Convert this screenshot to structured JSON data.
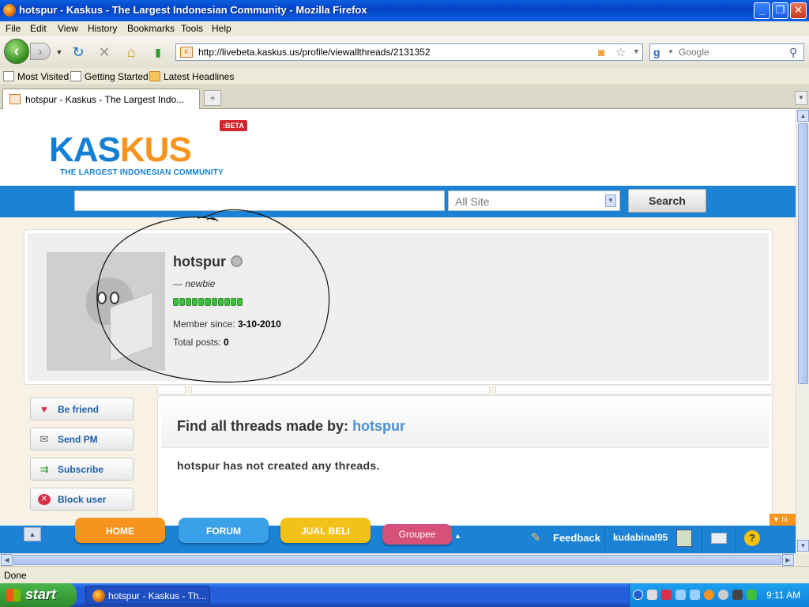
{
  "window": {
    "title": "hotspur - Kaskus - The Largest Indonesian Community - Mozilla Firefox",
    "controls": {
      "minimize": "_",
      "maximize": "❐",
      "close": "✕"
    }
  },
  "menu": [
    "File",
    "Edit",
    "View",
    "History",
    "Bookmarks",
    "Tools",
    "Help"
  ],
  "nav": {
    "url": "http://livebeta.kaskus.us/profile/viewallthreads/2131352",
    "search_placeholder": "Google"
  },
  "bookmarks": [
    "Most Visited",
    "Getting Started",
    "Latest Headlines"
  ],
  "tab": {
    "label": "hotspur - Kaskus - The Largest Indo..."
  },
  "kaskus": {
    "logo": {
      "part1": "KAS",
      "part2": "KUS",
      "tagline": "THE LARGEST INDONESIAN COMMUNITY",
      "beta": ":BETA"
    },
    "search": {
      "scope": "All Site",
      "button": "Search",
      "value": ""
    },
    "profile": {
      "name": "hotspur",
      "rank": "— newbie",
      "member_since_label": "Member since:",
      "member_since": "3-10-2010",
      "total_posts_label": "Total posts:",
      "total_posts": "0",
      "reputation_segments": 11
    },
    "actions": [
      {
        "label": "Be friend",
        "icon": "heart-icon"
      },
      {
        "label": "Send PM",
        "icon": "envelope-icon"
      },
      {
        "label": "Subscribe",
        "icon": "subscribe-icon"
      },
      {
        "label": "Block user",
        "icon": "block-icon"
      }
    ],
    "threads": {
      "heading": "Find all threads made by:",
      "user": "hotspur",
      "empty_message": "hotspur has not created any threads."
    },
    "bottom_bar": {
      "tabs": [
        {
          "label": "HOME",
          "color": "#f7941e"
        },
        {
          "label": "FORUM",
          "color": "#3aa0e8"
        },
        {
          "label": "JUAL BELI",
          "color": "#f2c21a"
        },
        {
          "label": "Groupee",
          "color": "#d6507a"
        }
      ],
      "feedback": "Feedback",
      "username": "kudabinal95",
      "hide_label": "▼ hi"
    }
  },
  "status": {
    "text": "Done"
  },
  "taskbar": {
    "start": "start",
    "item": "hotspur - Kaskus - Th...",
    "clock": "9:11 AM"
  }
}
